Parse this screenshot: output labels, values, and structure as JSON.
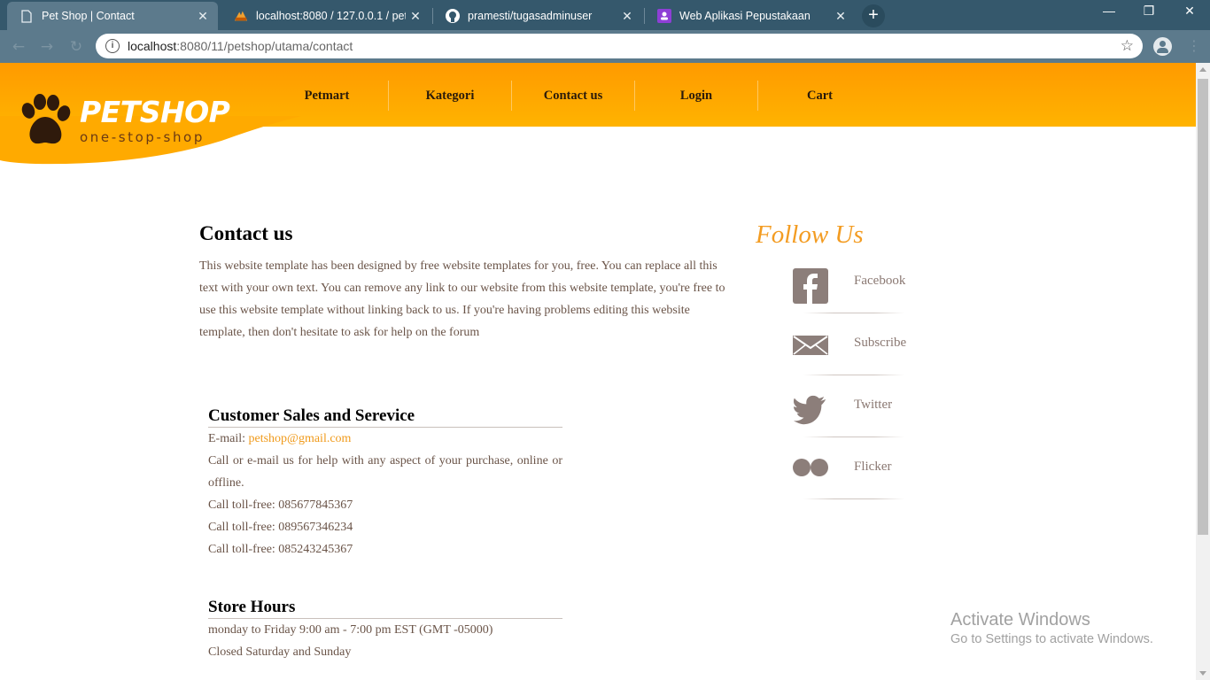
{
  "browser": {
    "tabs": [
      {
        "title": "Pet Shop | Contact",
        "icon": "page-icon",
        "active": true
      },
      {
        "title": "localhost:8080 / 127.0.0.1 / petsh",
        "icon": "phpmyadmin-icon",
        "active": false
      },
      {
        "title": "pramesti/tugasadminuser",
        "icon": "github-icon",
        "active": false
      },
      {
        "title": "Web Aplikasi Pepustakaan",
        "icon": "classroom-icon",
        "active": false
      }
    ],
    "new_tab": "+",
    "url_host": "localhost",
    "url_path": ":8080/11/petshop/utama/contact"
  },
  "site": {
    "logo_title": "PETSHOP",
    "logo_subtitle": "one-stop-shop",
    "nav": [
      "Petmart",
      "Kategori",
      "Contact us",
      "Login",
      "Cart"
    ]
  },
  "contact": {
    "title": "Contact us",
    "intro": "This website template has been designed by free website templates for you, free. You can replace all this text with your own text. You can remove any link to our website from this website template, you're free to use this website template without linking back to us. If you're having problems editing this website template, then don't hesitate to ask for help on the forum"
  },
  "sales": {
    "title": "Customer Sales and Serevice",
    "email_label": "E-mail: ",
    "email": "petshop@gmail.com",
    "help": "Call or e-mail us for help with any aspect of your purchase, online or offline.",
    "phones": [
      "Call toll-free: 085677845367",
      "Call toll-free: 089567346234",
      "Call toll-free: 085243245367"
    ]
  },
  "hours": {
    "title": "Store Hours",
    "weekdays": "monday to Friday 9:00 am - 7:00 pm EST (GMT -05000)",
    "weekend": "Closed Saturday and Sunday"
  },
  "follow": {
    "title": "Follow Us",
    "items": [
      {
        "label": "Facebook",
        "icon": "facebook-icon"
      },
      {
        "label": "Subscribe",
        "icon": "mail-icon"
      },
      {
        "label": "Twitter",
        "icon": "twitter-icon"
      },
      {
        "label": "Flicker",
        "icon": "flickr-icon"
      }
    ]
  },
  "watermark": {
    "line1": "Activate Windows",
    "line2": "Go to Settings to activate Windows."
  },
  "colors": {
    "header": "#ffa500",
    "accent": "#f39c22",
    "tabbar": "#35586c"
  }
}
